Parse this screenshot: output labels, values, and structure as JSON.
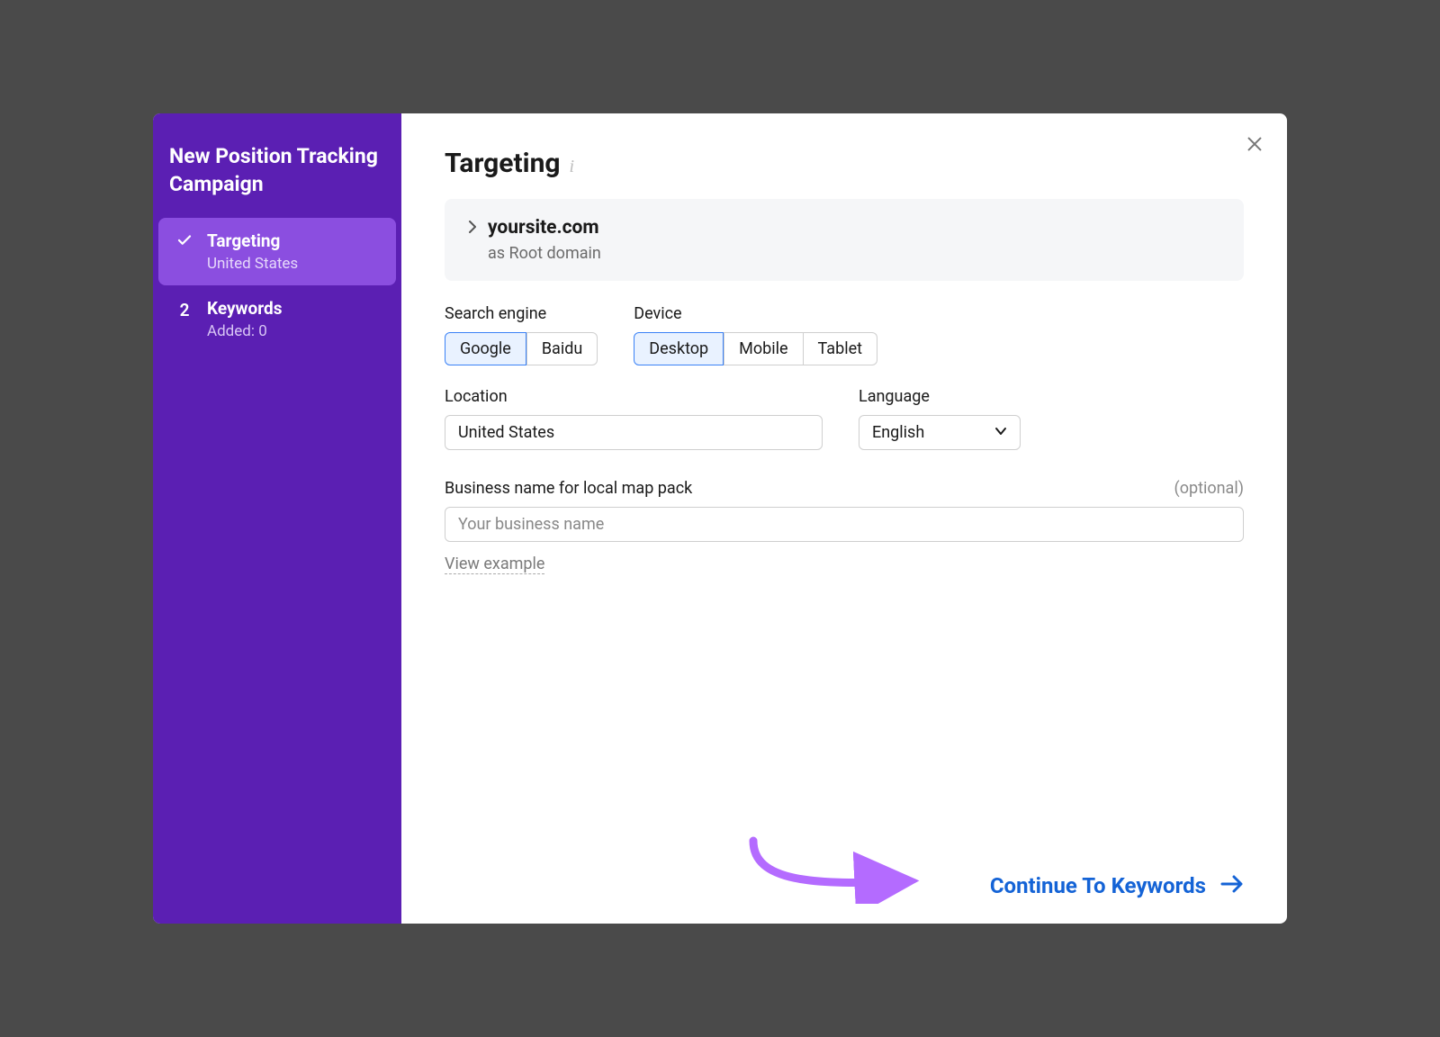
{
  "sidebar": {
    "title": "New Position Tracking Campaign",
    "steps": [
      {
        "label": "Targeting",
        "sub": "United States"
      },
      {
        "label": "Keywords",
        "sub": "Added: 0",
        "num": "2"
      }
    ]
  },
  "main": {
    "title": "Targeting",
    "domain": {
      "name": "yoursite.com",
      "sub": "as Root domain"
    },
    "search_engine": {
      "label": "Search engine",
      "options": [
        "Google",
        "Baidu"
      ],
      "selected": "Google"
    },
    "device": {
      "label": "Device",
      "options": [
        "Desktop",
        "Mobile",
        "Tablet"
      ],
      "selected": "Desktop"
    },
    "location": {
      "label": "Location",
      "value": "United States"
    },
    "language": {
      "label": "Language",
      "value": "English"
    },
    "business": {
      "label": "Business name for local map pack",
      "optional": "(optional)",
      "placeholder": "Your business name"
    },
    "view_example": "View example",
    "continue": "Continue To Keywords"
  }
}
